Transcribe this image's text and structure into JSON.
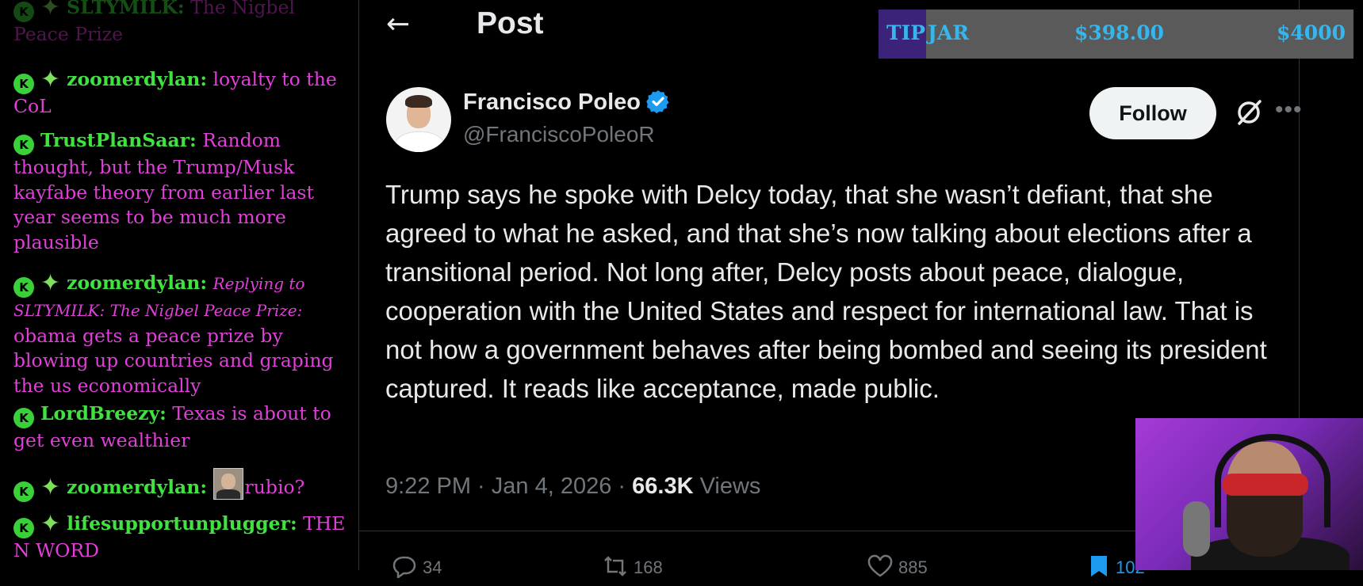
{
  "chat": {
    "messages": [
      {
        "user": "SLTYMILK:",
        "text": "The Nigbel Peace Prize"
      },
      {
        "user": "zoomerdylan:",
        "text": "loyalty to the CoL"
      },
      {
        "user": "TrustPlanSaar:",
        "text": "Random thought, but the Trump/Musk kayfabe theory from earlier last year seems to be much more plausible"
      },
      {
        "user": "zoomerdylan:",
        "reply": "Replying to SLTYMILK: The Nigbel Peace Prize:",
        "text": "obama gets a peace prize by blowing up countries and graping the us economically"
      },
      {
        "user": "LordBreezy:",
        "text": "Texas is about to get even wealthier"
      },
      {
        "user": "zoomerdylan:",
        "text": "rubio?"
      },
      {
        "user": "lifesupportunplugger:",
        "text": "THE N WORD"
      }
    ],
    "badge_letter": "K"
  },
  "post": {
    "back_icon": "arrow-left-icon",
    "title": "Post",
    "author": {
      "name": "Francisco Poleo",
      "handle": "@FranciscoPoleoR",
      "verified": true
    },
    "follow_label": "Follow",
    "text": "Trump says he spoke with Delcy today, that she wasn’t defiant, that she agreed to what he asked, and that she’s now talking about elections after a transitional period. Not long after, Delcy posts about peace, dialogue, cooperation with the United States and respect for international law. That is not how a government behaves after being bombed and seeing its president captured. It reads like acceptance, made public.",
    "time": "9:22 PM · Jan 4, 2026 · ",
    "views_count": "66.3K",
    "views_label": " Views",
    "actions": {
      "replies": "34",
      "reposts": "168",
      "likes": "885",
      "bookmarks": "102"
    }
  },
  "tipjar": {
    "label_tip": "TIP",
    "label_jar": "JAR",
    "current": "$398.00",
    "goal": "$4000",
    "progress_fraction": 0.0995
  },
  "colors": {
    "accent_blue": "#1d9bf0",
    "chat_username": "#3fe23f",
    "chat_text": "#e040d8",
    "tipjar_text": "#35b7ee"
  }
}
